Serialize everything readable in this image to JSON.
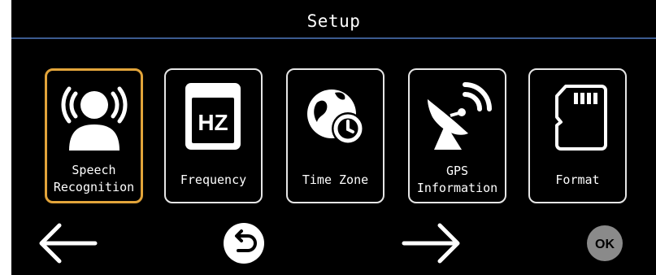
{
  "header": {
    "title": "Setup"
  },
  "menu": {
    "items": [
      {
        "label": "Speech\nRecognition",
        "icon": "speech-recognition-icon",
        "selected": true
      },
      {
        "label": "Frequency",
        "icon": "frequency-hz-icon",
        "icon_text": "HZ"
      },
      {
        "label": "Time Zone",
        "icon": "globe-clock-icon"
      },
      {
        "label": "GPS\nInformation",
        "icon": "satellite-dish-icon"
      },
      {
        "label": "Format",
        "icon": "sd-card-icon"
      }
    ]
  },
  "navigation": {
    "back_icon": "arrow-left-icon",
    "return_icon": "return-icon",
    "next_icon": "arrow-right-icon",
    "ok_label": "OK"
  },
  "colors": {
    "background": "#000000",
    "divider": "#3b5a8f",
    "selected_border": "#e2a43a",
    "tile_border": "#e6e6e6",
    "ok_disabled": "#8a8a8a"
  }
}
